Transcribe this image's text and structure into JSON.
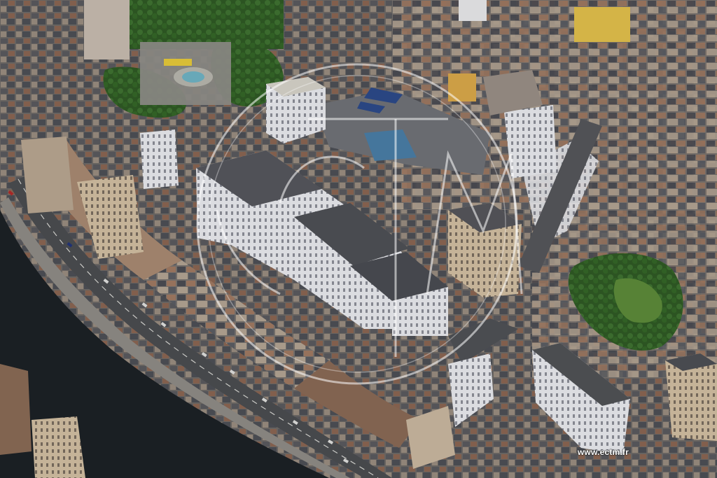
{
  "watermark": {
    "text": "www.ectm.fr"
  },
  "colors": {
    "river": "#1c2126",
    "quay_road": "#4b4d50",
    "park_green": "#3c6a2c",
    "roof_dark": "#4a4c50",
    "roof_brick": "#8a5a46",
    "facade_white": "#e6e7ea",
    "facade_beige": "#cdb99a"
  }
}
